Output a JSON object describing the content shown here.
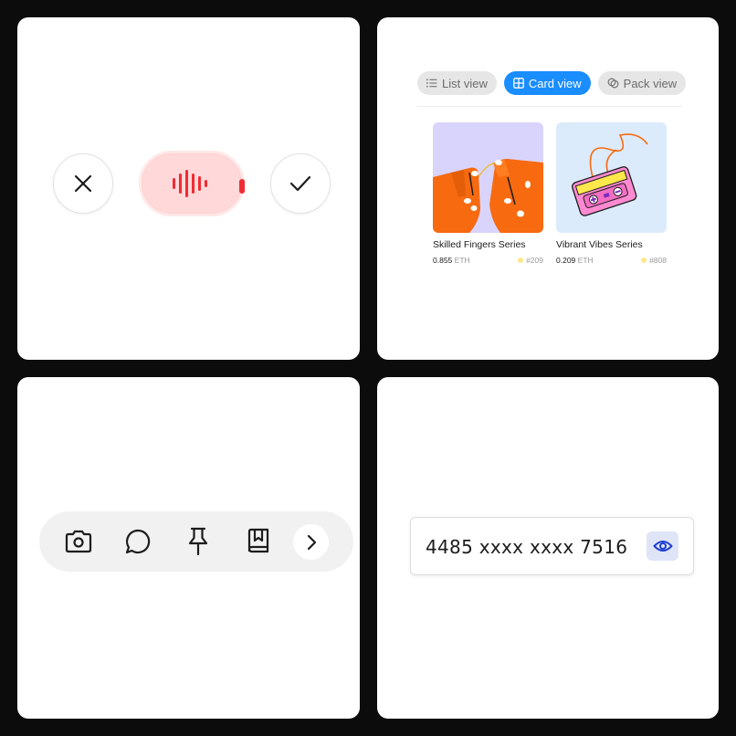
{
  "voice_recorder": {
    "icons": {
      "cancel": "close-icon",
      "confirm": "check-icon",
      "recording": "waveform-icon"
    },
    "colors": {
      "accent": "#f02b34",
      "pill_bg": "#ffd9d9"
    }
  },
  "view_switcher": {
    "tabs": [
      {
        "label": "List view",
        "icon": "list-icon",
        "active": false
      },
      {
        "label": "Card view",
        "icon": "grid-icon",
        "active": true
      },
      {
        "label": "Pack view",
        "icon": "pack-icon",
        "active": false
      }
    ],
    "accent": "#1a8dff",
    "cards": [
      {
        "title": "Skilled Fingers Series",
        "price": "0.855",
        "unit": "ETH",
        "number": "#209"
      },
      {
        "title": "Vibrant Vibes Series",
        "price": "0.209",
        "unit": "ETH",
        "number": "#808"
      }
    ]
  },
  "toolbar": {
    "icons": [
      "camera-icon",
      "chat-icon",
      "pin-icon",
      "bookmark-book-icon",
      "chevron-right-icon"
    ]
  },
  "card_field": {
    "number": "4485 xxxx xxxx 7516",
    "icon": "eye-icon",
    "accent": "#1d3fd1"
  }
}
